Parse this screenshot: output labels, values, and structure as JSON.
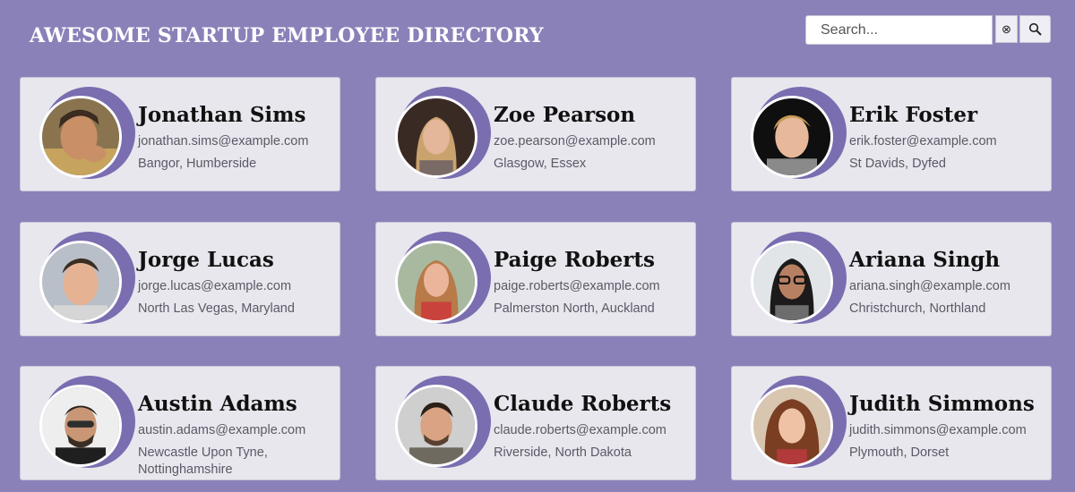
{
  "header": {
    "title": "AWESOME STARTUP EMPLOYEE DIRECTORY"
  },
  "search": {
    "placeholder": "Search...",
    "value": "",
    "clear_icon": "circled-x-icon",
    "submit_icon": "magnifier-icon"
  },
  "colors": {
    "background": "#8b81b9",
    "card": "#e8e7ee",
    "accent": "#7a6db0"
  },
  "employees": [
    {
      "name": "Jonathan Sims",
      "email": "jonathan.sims@example.com",
      "location": "Bangor, Humberside"
    },
    {
      "name": "Zoe Pearson",
      "email": "zoe.pearson@example.com",
      "location": "Glasgow, Essex"
    },
    {
      "name": "Erik Foster",
      "email": "erik.foster@example.com",
      "location": "St Davids, Dyfed"
    },
    {
      "name": "Jorge Lucas",
      "email": "jorge.lucas@example.com",
      "location": "North Las Vegas, Maryland"
    },
    {
      "name": "Paige Roberts",
      "email": "paige.roberts@example.com",
      "location": "Palmerston North, Auckland"
    },
    {
      "name": "Ariana Singh",
      "email": "ariana.singh@example.com",
      "location": "Christchurch, Northland"
    },
    {
      "name": "Austin Adams",
      "email": "austin.adams@example.com",
      "location": "Newcastle Upon Tyne, Nottinghamshire"
    },
    {
      "name": "Claude Roberts",
      "email": "claude.roberts@example.com",
      "location": "Riverside, North Dakota"
    },
    {
      "name": "Judith Simmons",
      "email": "judith.simmons@example.com",
      "location": "Plymouth, Dorset"
    }
  ]
}
